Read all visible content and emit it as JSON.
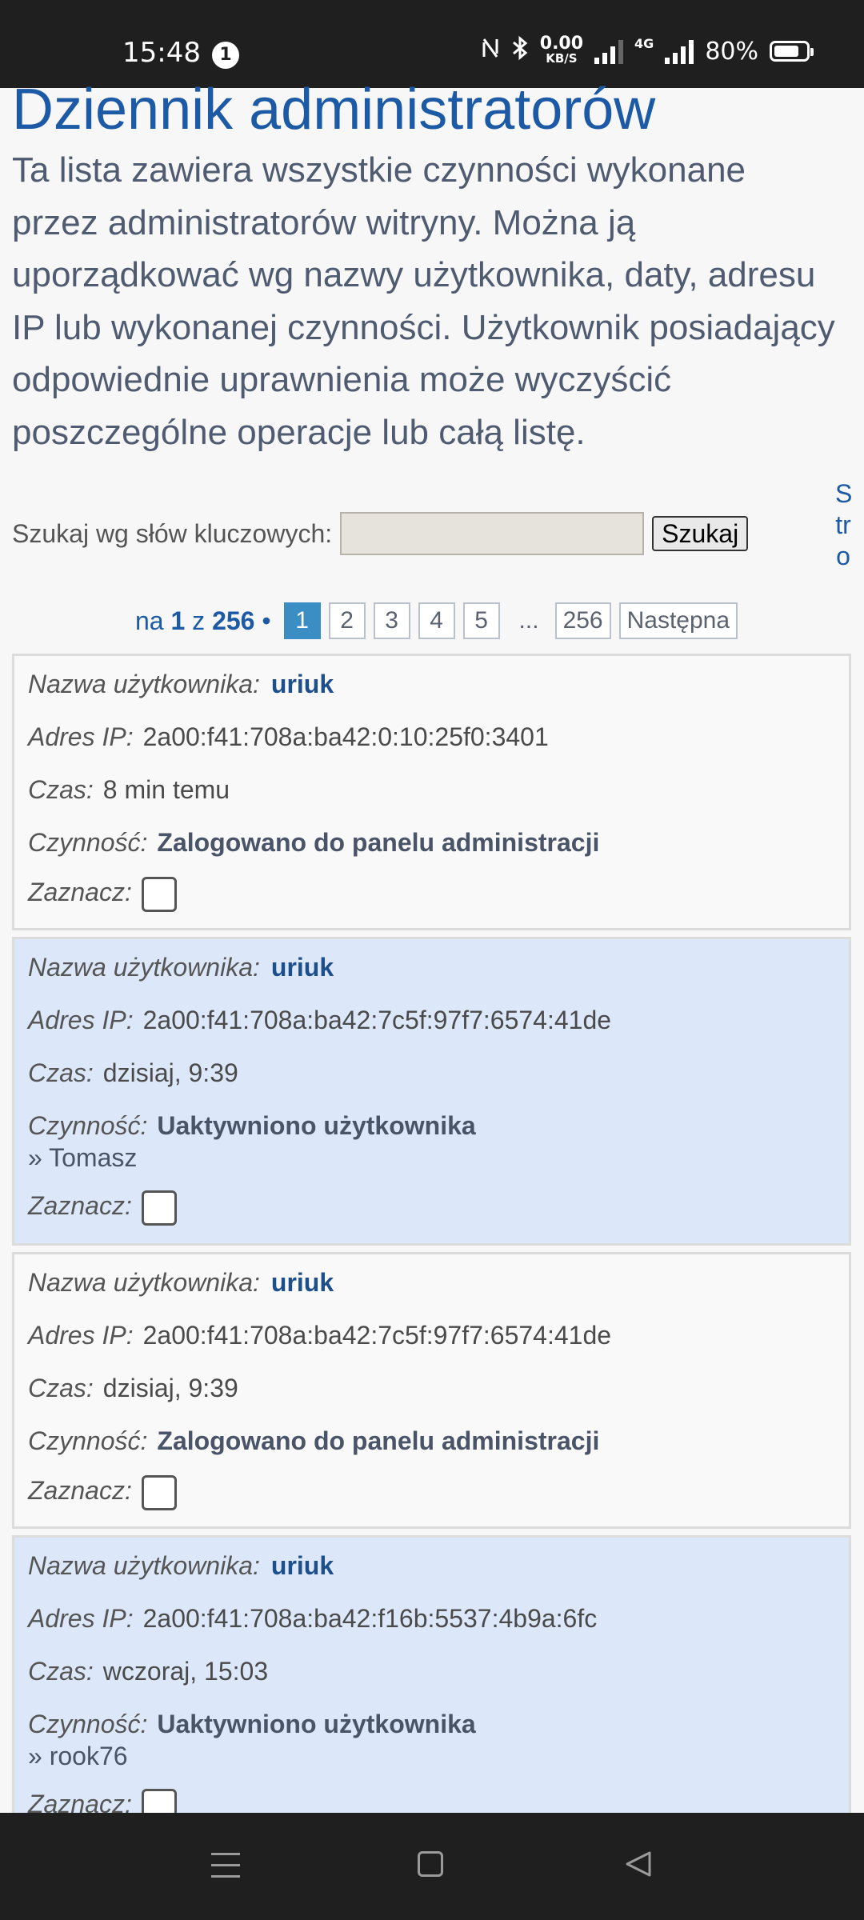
{
  "status_bar": {
    "time": "15:48",
    "notification_count": "1",
    "net_speed_value": "0.00",
    "net_speed_unit": "KB/S",
    "network_type": "4G",
    "battery": "80%",
    "battery_level": 0.8
  },
  "page": {
    "title": "Dziennik administratorów",
    "description": "Ta lista zawiera wszystkie czynności wykonane przez administratorów witryny. Można ją uporządkować wg nazwy użytkownika, daty, adresu IP lub wykonanej czynności. Użytkownik posiadający odpowiednie uprawnienia może wyczyścić poszczególne operacje lub całą listę."
  },
  "search": {
    "label": "Szukaj wg słów kluczowych:",
    "value": "",
    "button": "Szukaj",
    "side_label": "Stro"
  },
  "pagination": {
    "prefix": "na",
    "current": "1",
    "of": "z",
    "total": "256",
    "separator": "•",
    "pages": [
      "1",
      "2",
      "3",
      "4",
      "5"
    ],
    "ellipsis": "...",
    "last": "256",
    "next": "Następna"
  },
  "labels": {
    "user": "Nazwa użytkownika:",
    "ip": "Adres IP:",
    "time": "Czas:",
    "action": "Czynność:",
    "select": "Zaznacz:"
  },
  "entries": [
    {
      "user": "uriuk",
      "ip": "2a00:f41:708a:ba42:0:10:25f0:3401",
      "time": "8 min temu",
      "action": "Zalogowano do panelu administracji",
      "target": ""
    },
    {
      "user": "uriuk",
      "ip": "2a00:f41:708a:ba42:7c5f:97f7:6574:41de",
      "time": "dzisiaj, 9:39",
      "action": "Uaktywniono użytkownika",
      "target": "» Tomasz"
    },
    {
      "user": "uriuk",
      "ip": "2a00:f41:708a:ba42:7c5f:97f7:6574:41de",
      "time": "dzisiaj, 9:39",
      "action": "Zalogowano do panelu administracji",
      "target": ""
    },
    {
      "user": "uriuk",
      "ip": "2a00:f41:708a:ba42:f16b:5537:4b9a:6fc",
      "time": "wczoraj, 15:03",
      "action": "Uaktywniono użytkownika",
      "target": "» rook76"
    }
  ]
}
